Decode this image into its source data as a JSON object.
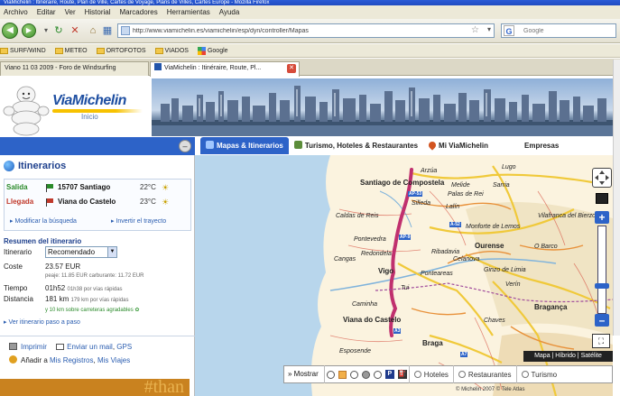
{
  "browser": {
    "title": "ViaMichelin : Itinéraire, Route, Plan de Ville, Cartes de Voyage, Plans de Villes, Cartes Europe - Mozilla Firefox",
    "menu": [
      "Archivo",
      "Editar",
      "Ver",
      "Historial",
      "Marcadores",
      "Herramientas",
      "Ayuda"
    ],
    "url": "http://www.viamichelin.es/viamichelin/esp/dyn/controller/Mapas",
    "search_placeholder": "Google",
    "bookmarks": [
      {
        "label": "SURF/WIND",
        "icon": "folder-icon"
      },
      {
        "label": "METEO",
        "icon": "folder-icon"
      },
      {
        "label": "ORTOFOTOS",
        "icon": "folder-icon"
      },
      {
        "label": "VIADOS",
        "icon": "folder-icon"
      },
      {
        "label": "Google",
        "icon": "google-icon"
      }
    ],
    "tabs": [
      {
        "label": "Viano 11 03 2009 - Foro de Windsurfing"
      },
      {
        "label": "ViaMichelin : Itinéraire, Route, Pl..."
      }
    ]
  },
  "header": {
    "logo": "ViaMichelin",
    "inicio": "Inicio"
  },
  "nav_tabs": [
    {
      "label": "Mapas & Itinerarios"
    },
    {
      "label": "Turismo, Hoteles & Restaurantes"
    },
    {
      "label": "Mi ViaMichelin"
    },
    {
      "label": "Empresas"
    }
  ],
  "itinerary": {
    "title": "Itinerarios",
    "origin": {
      "label": "Salida",
      "city": "15707 Santiago",
      "temp": "22°C"
    },
    "destination": {
      "label": "Llegada",
      "city": "Viana do Castelo",
      "temp": "23°C"
    },
    "modify_link": "Modificar la búsqueda",
    "reverse_link": "Invertir el trayecto",
    "summary_title": "Resumen del itinerario",
    "route_label": "Itinerario",
    "route_value": "Recomendado",
    "cost_label": "Coste",
    "cost_value": "23.57 EUR",
    "cost_detail": "peaje: 11.85 EUR  carburante: 11.72 EUR",
    "time_label": "Tiempo",
    "time_value": "01h52",
    "time_detail": "01h38 por vías rápidas",
    "distance_label": "Distancia",
    "distance_value": "181 km",
    "distance_detail": "179 km por vías rápidas",
    "extra_line": "y 10 km sobre carreteras agradables",
    "step_link": "Ver itinerario paso a paso",
    "print": "Imprimir",
    "mail": "Enviar un mail",
    "gps": "GPS",
    "add": "Añadir a",
    "my_records": "Mis Registros",
    "my_trips": "Mis Viajes",
    "banner": "#than"
  },
  "map": {
    "labels": [
      {
        "text": "Santiago de Compostela",
        "big": true
      },
      {
        "text": "Arzúa"
      },
      {
        "text": "Melide"
      },
      {
        "text": "Palas de Rei"
      },
      {
        "text": "Lalín"
      },
      {
        "text": "Silleda"
      },
      {
        "text": "Caldas de Reis"
      },
      {
        "text": "Cangas"
      },
      {
        "text": "Pontevedra"
      },
      {
        "text": "Vigo",
        "big": true
      },
      {
        "text": "Ourense",
        "big": true
      },
      {
        "text": "Redondela"
      },
      {
        "text": "Ponteareas"
      },
      {
        "text": "Tui"
      },
      {
        "text": "Caminha"
      },
      {
        "text": "Viana do Castelo",
        "big": true
      },
      {
        "text": "Braga",
        "big": true
      },
      {
        "text": "Bragança",
        "big": true
      },
      {
        "text": "Chaves"
      },
      {
        "text": "Esposende"
      },
      {
        "text": "Monforte de Lemos"
      },
      {
        "text": "Verín"
      },
      {
        "text": "Ginzo de Limia"
      },
      {
        "text": "Celanova"
      },
      {
        "text": "Ribadavia"
      },
      {
        "text": "Vilafranca del Bierzo"
      },
      {
        "text": "O Barco"
      },
      {
        "text": "Sarria"
      },
      {
        "text": "Lugo"
      }
    ],
    "map_types": "Mapa | Híbrido | Satélite",
    "legend": {
      "show": "Mostrar",
      "hotels": "Hoteles",
      "restaurants": "Restaurantes",
      "tourism": "Turismo"
    },
    "copyright": "© Michelin 2007 © Tele Atlas"
  },
  "colors": {
    "accent": "#2d63c8",
    "route": "#c0306e",
    "brand": "#1d4ea1"
  }
}
